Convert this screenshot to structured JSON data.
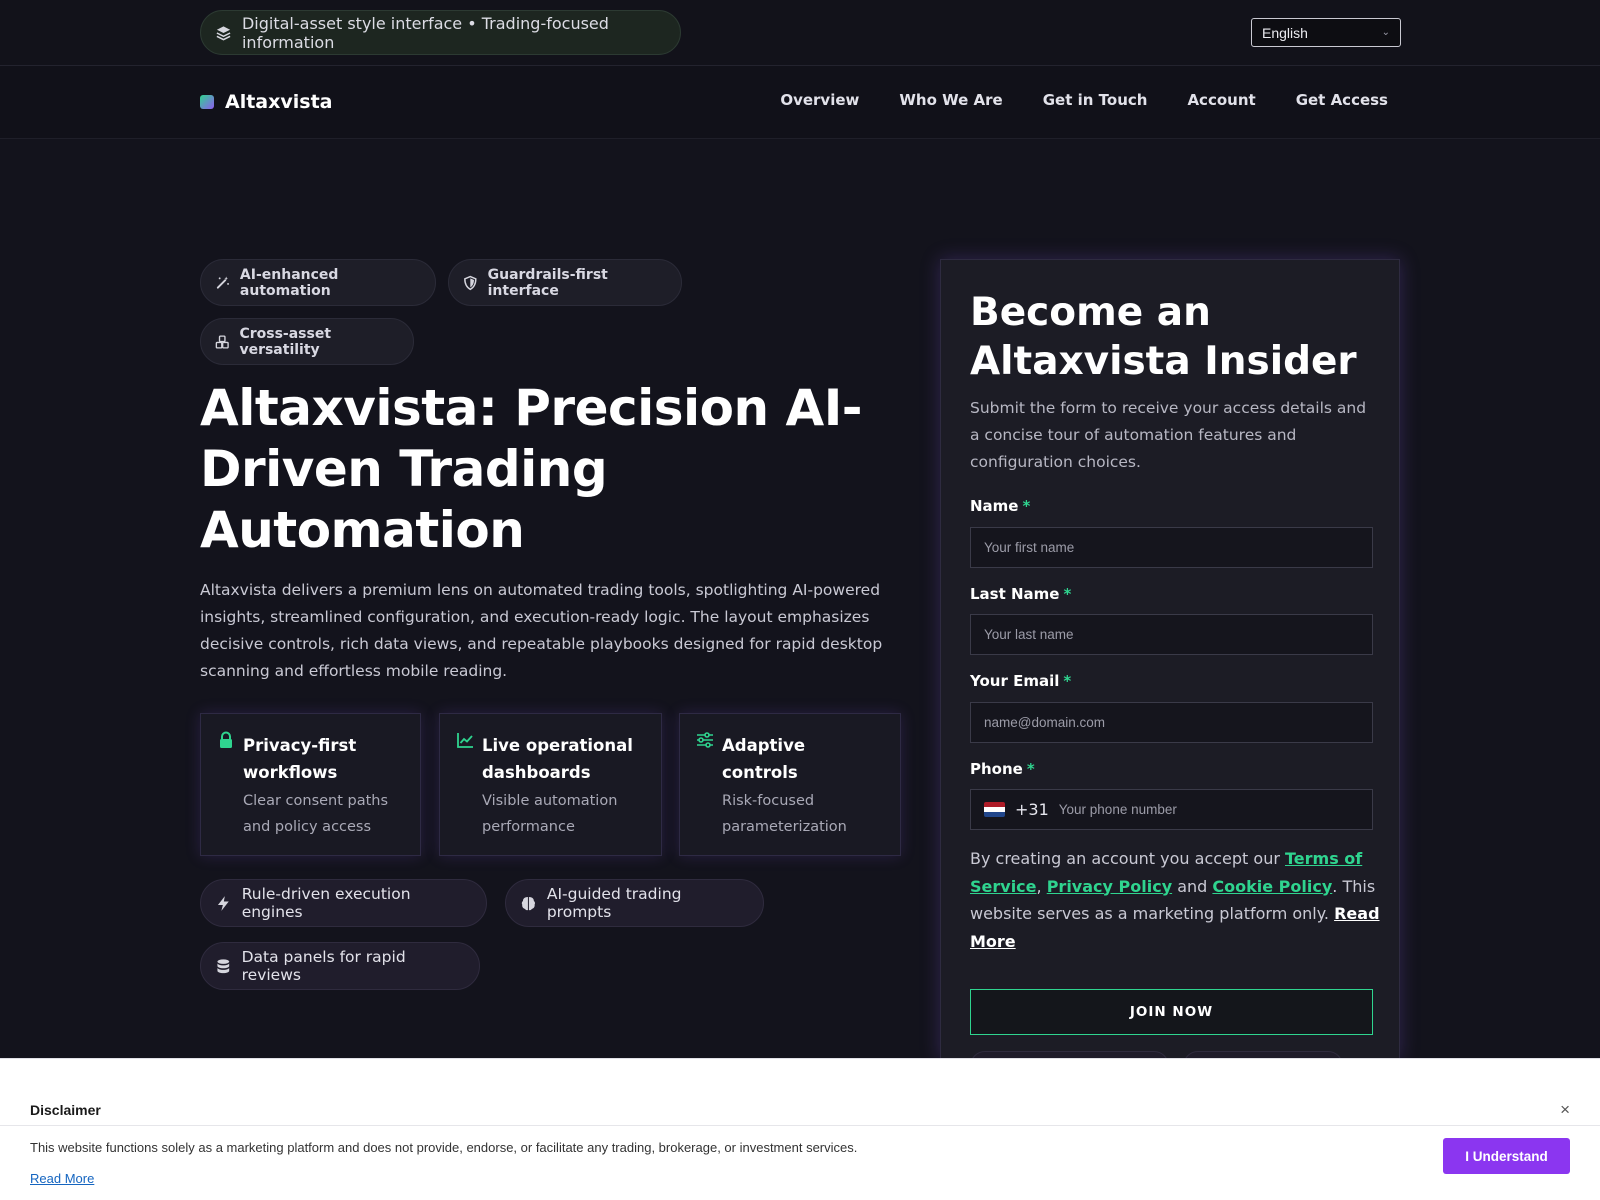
{
  "topstrip": {
    "pill_text": "Digital-asset style interface • Trading-focused information",
    "language": "English"
  },
  "nav": {
    "brand": "Altaxvista",
    "links": [
      "Overview",
      "Who We Are",
      "Get in Touch",
      "Account",
      "Get Access"
    ]
  },
  "hero": {
    "feature_pills": [
      "AI-enhanced automation",
      "Guardrails-first interface",
      "Cross-asset versatility"
    ],
    "title": "Altaxvista: Precision AI-Driven Trading Automation",
    "description": "Altaxvista delivers a premium lens on automated trading tools, spotlighting AI-powered insights, streamlined configuration, and execution-ready logic. The layout emphasizes decisive controls, rich data views, and repeatable playbooks designed for rapid desktop scanning and effortless mobile reading.",
    "cards": [
      {
        "title": "Privacy-first workflows",
        "sub": "Clear consent paths and policy access",
        "icon": "lock-icon"
      },
      {
        "title": "Live operational dashboards",
        "sub": "Visible automation performance",
        "icon": "chart-line-icon"
      },
      {
        "title": "Adaptive controls",
        "sub": "Risk-focused parameterization",
        "icon": "sliders-icon"
      }
    ],
    "bottom_pills": [
      "Rule-driven execution engines",
      "AI-guided trading prompts",
      "Data panels for rapid reviews"
    ]
  },
  "form": {
    "title": "Become an Altaxvista Insider",
    "subtitle": "Submit the form to receive your access details and a concise tour of automation features and configuration choices.",
    "name_label": "Name",
    "name_placeholder": "Your first name",
    "lastname_label": "Last Name",
    "lastname_placeholder": "Your last name",
    "email_label": "Your Email",
    "email_placeholder": "name@domain.com",
    "phone_label": "Phone",
    "phone_code": "+31",
    "phone_placeholder": "Your phone number",
    "required_mark": "*",
    "consent_prefix": "By creating an account you accept our ",
    "terms": "Terms of Service",
    "comma": ",",
    "privacy": "Privacy Policy",
    "and": " and ",
    "cookie": "Cookie Policy",
    "consent_suffix": ". This website serves as a marketing platform only. ",
    "read_more": "Read More",
    "join": "JOIN NOW"
  },
  "disclaimer": {
    "title": "Disclaimer",
    "close": "×",
    "text": "This website functions solely as a marketing platform and does not provide, endorse, or facilitate any trading, brokerage, or investment services.",
    "read_more": "Read More",
    "button": "I Understand"
  },
  "colors": {
    "accent_green": "#2fd48f",
    "accent_purple": "#8b36f0",
    "background": "#13131c"
  }
}
